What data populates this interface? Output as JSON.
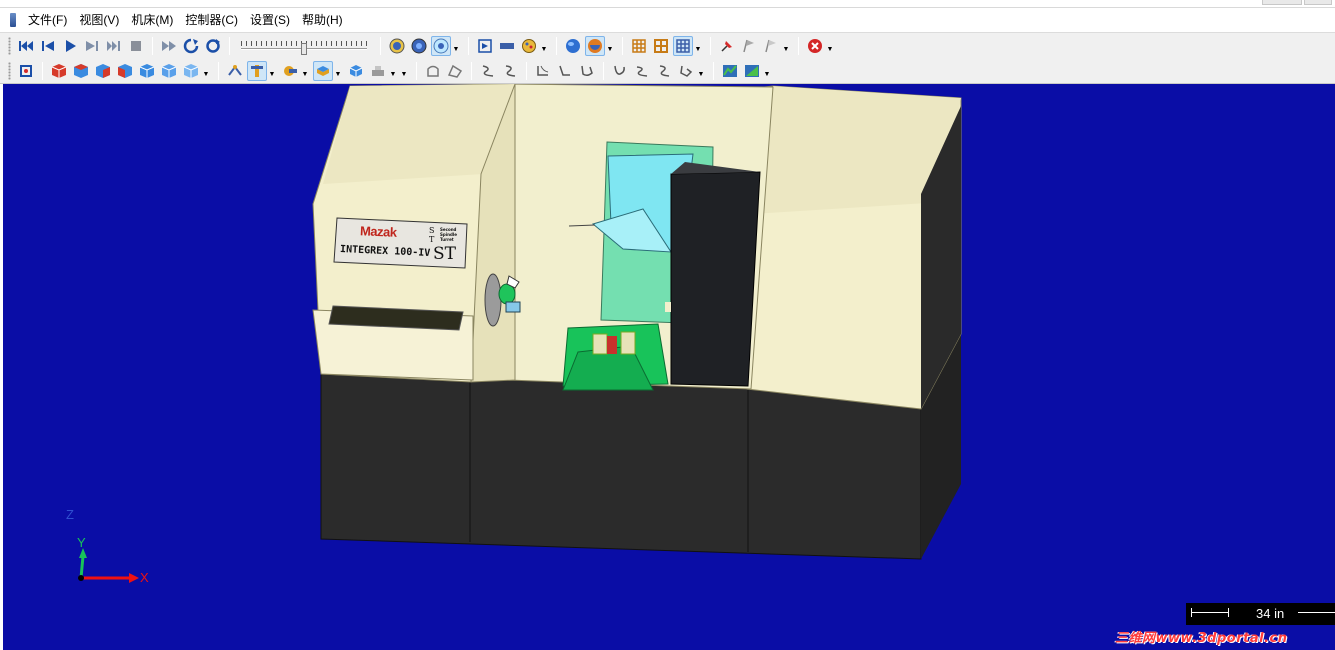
{
  "menu": [
    "文件(F)",
    "视图(V)",
    "机床(M)",
    "控制器(C)",
    "设置(S)",
    "帮助(H)"
  ],
  "toolbar1": {
    "playback": [
      "rewind-to-start-icon",
      "step-back-icon",
      "play-icon",
      "step-forward-icon",
      "fast-forward-icon",
      "stop-icon"
    ],
    "loop": [
      "skip-forward-icon",
      "rotate-icon",
      "cycle-icon"
    ],
    "speed_slider_position": 0.5,
    "views": [
      "view-gauge-icon",
      "view-globe-icon",
      "view-panel-icon"
    ],
    "tools": [
      "frame-select-icon",
      "ruler-icon",
      "palette-icon"
    ],
    "shading": [
      "sphere-icon",
      "shaded-sphere-icon"
    ],
    "grids": [
      "grid-a-icon",
      "grid-b-icon",
      "grid-c-icon"
    ],
    "markers": [
      "pin-icon",
      "flag-icon",
      "flag-outline-icon"
    ],
    "stop": "close-circle-icon"
  },
  "toolbar2": {
    "fit": "fit-view-icon",
    "cubes": [
      "cube-front-icon",
      "cube-top-icon",
      "cube-right-icon",
      "cube-left-icon",
      "cube-iso-icon",
      "cube-back-icon",
      "cube-bottom-icon"
    ],
    "tool_tools": [
      "tool-path-icon",
      "tool-holder-icon",
      "spindle-icon",
      "workpiece-icon",
      "stock-icon",
      "fixture-icon"
    ],
    "shapes": [
      "shape-a-icon",
      "shape-b-icon"
    ],
    "curves": [
      "curve-a-icon",
      "curve-b-icon",
      "curve-c-icon",
      "curve-d-icon",
      "curve-e-icon",
      "curve-f-icon",
      "curve-g-icon",
      "curve-h-icon",
      "curve-i-icon"
    ],
    "charts": [
      "chart-a-icon",
      "chart-b-icon"
    ]
  },
  "machine": {
    "brand": "Mazak",
    "model": "INTEGREX 100-IV",
    "series": "ST",
    "plate_letters": [
      "S",
      "T"
    ],
    "plate_smalltext": [
      "Second",
      "Spindle",
      "Turret"
    ]
  },
  "axes": {
    "x": "X",
    "y": "Y",
    "z": "Z"
  },
  "scale": {
    "label": "34 in"
  },
  "credit": "三维网www.3dportal.cn",
  "colors": {
    "viewport_bg": "#0a0da6",
    "machine_cream": "#f3efcc",
    "machine_base": "#2b2b2b",
    "door_dark": "#1f2125",
    "spindle_cyan": "#7fe6f2",
    "turret_green": "#18c35a",
    "panel_green": "#74dfb0"
  }
}
